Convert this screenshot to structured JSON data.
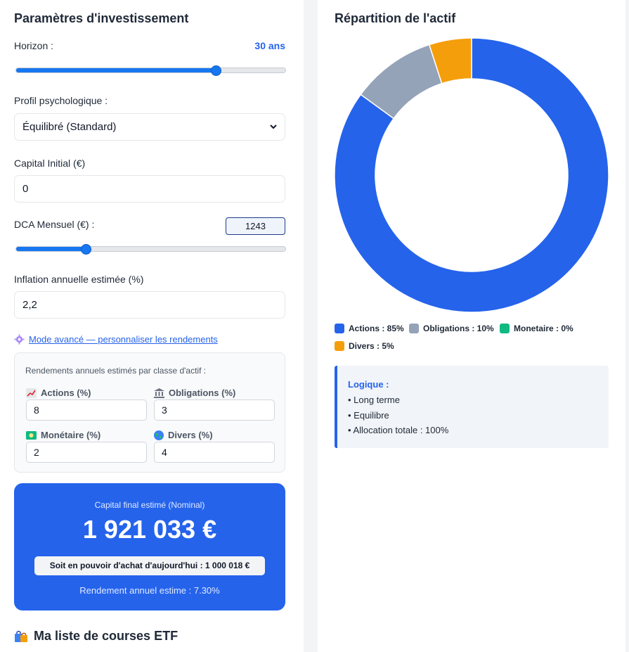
{
  "left": {
    "title": "Paramètres d'investissement",
    "horizon": {
      "label": "Horizon :",
      "value_text": "30 ans",
      "slider_fraction": 0.74
    },
    "profile": {
      "label": "Profil psychologique :",
      "selected": "Équilibré (Standard)"
    },
    "capital": {
      "label": "Capital Initial (€)",
      "value": "0"
    },
    "dca": {
      "label": "DCA Mensuel (€) :",
      "value": "1243",
      "slider_fraction": 0.26
    },
    "inflation": {
      "label": "Inflation annuelle estimée (%)",
      "value": "2,2"
    },
    "advanced_link": "Mode avancé — personnaliser les rendements",
    "advanced": {
      "description": "Rendements annuels estimés par classe d'actif :",
      "actions": {
        "label": "Actions (%)",
        "value": "8"
      },
      "obligations": {
        "label": "Obligations (%)",
        "value": "3"
      },
      "monetaire": {
        "label": "Monétaire (%)",
        "value": "2"
      },
      "divers": {
        "label": "Divers (%)",
        "value": "4"
      }
    },
    "result": {
      "label": "Capital final estimé (Nominal)",
      "value": "1 921 033 €",
      "purchasing_power": "Soit en pouvoir d'achat d'aujourd'hui : 1 000 018 €",
      "rendement": "Rendement annuel estime : 7.30%"
    },
    "etf_title": "Ma liste de courses ETF"
  },
  "right": {
    "title": "Répartition de l'actif",
    "legend": [
      {
        "label": "Actions : 85%"
      },
      {
        "label": "Obligations : 10%"
      },
      {
        "label": "Monetaire : 0%"
      },
      {
        "label": "Divers : 5%"
      }
    ],
    "logic": {
      "title": "Logique :",
      "lines": [
        "• Long terme",
        "• Equilibre",
        "• Allocation totale : 100%"
      ]
    }
  },
  "chart_data": {
    "type": "pie",
    "categories": [
      "Actions",
      "Obligations",
      "Monetaire",
      "Divers"
    ],
    "values": [
      85,
      10,
      0,
      5
    ],
    "colors": [
      "#2563eb",
      "#94a3b8",
      "#10b981",
      "#f59e0b"
    ],
    "title": "Répartition de l'actif"
  },
  "colors": {
    "accent": "#2563eb",
    "slider": "#1677f0"
  }
}
